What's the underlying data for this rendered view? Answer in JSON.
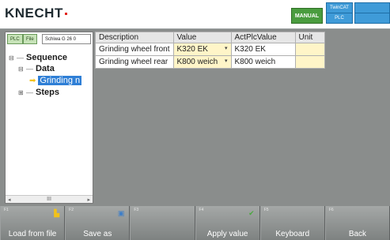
{
  "header": {
    "logo": "KNECHT",
    "mode": "MANUAL",
    "twincat_label": "TwinCAT",
    "twincat_plc": "PLC"
  },
  "sidebar": {
    "buttons": [
      "PLC",
      "File"
    ],
    "select_value": "Schiwa G 26 0",
    "tree": [
      {
        "label": "Sequence",
        "expander": "⊟"
      },
      {
        "label": "Data",
        "expander": "⊟"
      },
      {
        "label": "Grinding n",
        "expander": ""
      },
      {
        "label": "Steps",
        "expander": "⊞"
      }
    ],
    "scroll_mid": "III"
  },
  "table": {
    "columns": [
      "Description",
      "Value",
      "ActPlcValue",
      "Unit"
    ],
    "rows": [
      {
        "description": "Grinding wheel front",
        "value": "K320 EK",
        "act": "K320 EK",
        "unit": ""
      },
      {
        "description": "Grinding wheel rear",
        "value": "K800 weich",
        "act": "K800 weich",
        "unit": ""
      }
    ]
  },
  "fkeys": [
    {
      "num": "F1",
      "label": "Load from file",
      "icon": "document-icon"
    },
    {
      "num": "F2",
      "label": "Save as",
      "icon": "save-icon"
    },
    {
      "num": "F3",
      "label": "",
      "icon": ""
    },
    {
      "num": "F4",
      "label": "Apply value",
      "icon": "checkmark-icon"
    },
    {
      "num": "F5",
      "label": "Keyboard",
      "icon": ""
    },
    {
      "num": "F6",
      "label": "Back",
      "icon": ""
    }
  ],
  "colors": {
    "mode_green": "#4a9c3f",
    "twincat_blue": "#3f9bd8",
    "selection_blue": "#2f7fd6",
    "editable_yellow": "#fff5c8"
  }
}
